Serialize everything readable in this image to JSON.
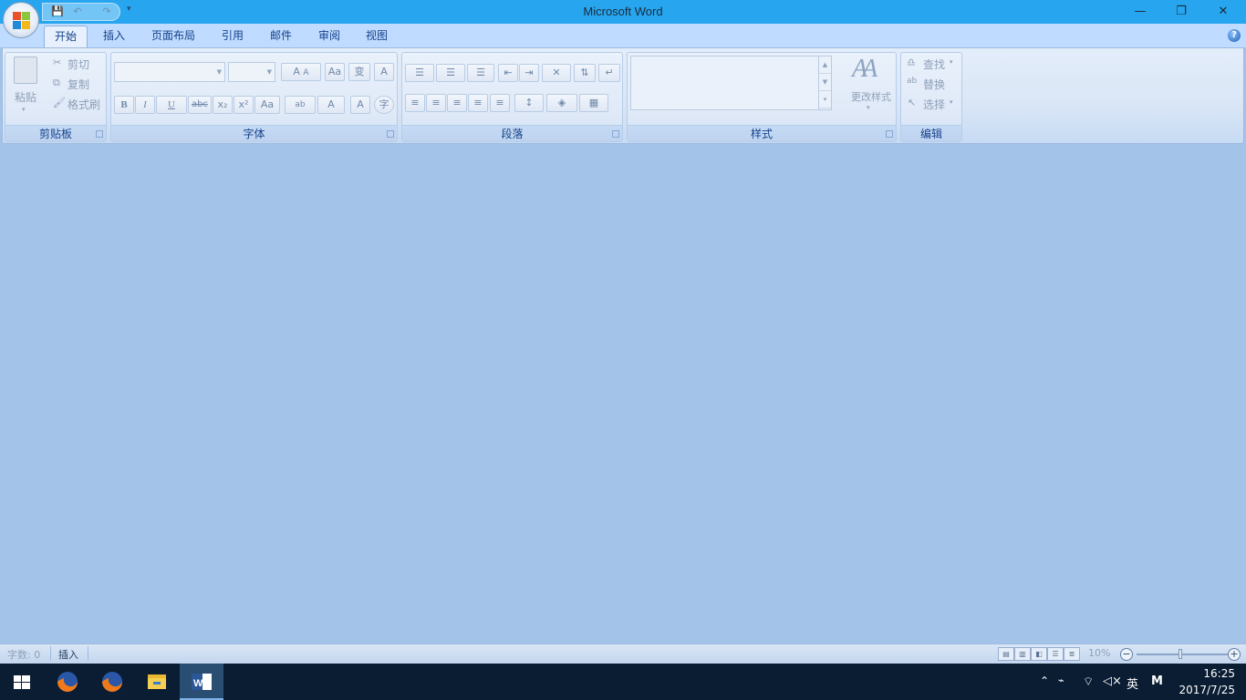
{
  "window": {
    "title": "Microsoft Word",
    "controls": [
      "—",
      "❐",
      "✕"
    ]
  },
  "qat": {
    "save": "💾",
    "undo": "↶",
    "redo": "↷",
    "more": "▾"
  },
  "tabs": [
    {
      "label": "开始",
      "active": true
    },
    {
      "label": "插入"
    },
    {
      "label": "页面布局"
    },
    {
      "label": "引用"
    },
    {
      "label": "邮件"
    },
    {
      "label": "审阅"
    },
    {
      "label": "视图"
    }
  ],
  "help": "?",
  "ribbon": {
    "clipboard": {
      "label": "剪贴板",
      "paste": "粘贴",
      "cut": "剪切",
      "copy": "复制",
      "format_painter": "格式刷"
    },
    "font": {
      "label": "字体",
      "row1": [
        "A",
        "A",
        "Aa",
        "变",
        "A"
      ],
      "row2": [
        "B",
        "I",
        "U",
        "abc",
        "x₂",
        "x²",
        "Aa",
        "ab",
        "A",
        "A",
        "字"
      ]
    },
    "paragraph": {
      "label": "段落",
      "row1": [
        "☰",
        "☰",
        "☰",
        "⇤",
        "⇥",
        "✕",
        "⇅",
        "↵"
      ],
      "row2": [
        "≡",
        "≡",
        "≡",
        "≡",
        "≡",
        "↕",
        "◈",
        "▦"
      ]
    },
    "styles": {
      "label": "样式",
      "change_styles": "更改样式",
      "icon_letters": "AA"
    },
    "editing": {
      "label": "编辑",
      "find": "查找",
      "replace": "替换",
      "select": "选择"
    }
  },
  "status": {
    "word_count": "字数: 0",
    "mode": "插入",
    "zoom": "10%",
    "zoom_minus": "−",
    "zoom_plus": "+"
  },
  "taskbar": {
    "ime": "英",
    "input_mode": "M",
    "time": "16:25",
    "date": "2017/7/25"
  },
  "colors": {
    "title_bar": "#27a6ef",
    "tab_row": "#bfdbff",
    "document_bg": "#a4c3e8",
    "taskbar": "#0b1d33"
  }
}
